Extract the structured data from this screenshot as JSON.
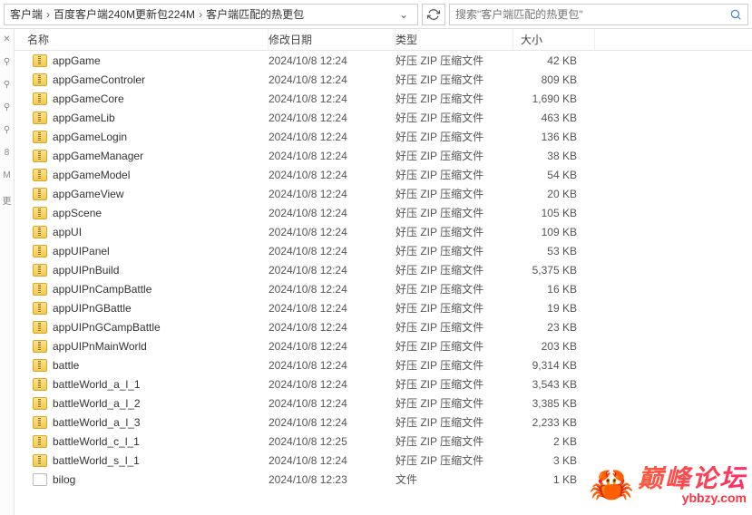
{
  "breadcrumb": {
    "seg1": "客户端",
    "seg2": "百度客户端240M更新包224M",
    "seg3": "客户端匹配的热更包"
  },
  "search": {
    "placeholder": "搜索\"客户端匹配的热更包\""
  },
  "columns": {
    "name": "名称",
    "date": "修改日期",
    "type": "类型",
    "size": "大小"
  },
  "leftStrip": {
    "i0": "✕",
    "i1": "⚲",
    "i2": "⚲",
    "i3": "⚲",
    "i4": "⚲",
    "i5": "8",
    "i6": "M",
    "i7": "更"
  },
  "watermark": {
    "crab": "🦀",
    "cn": "巅峰论坛",
    "url": "ybbzy.com"
  },
  "files": [
    {
      "name": "appGame",
      "date": "2024/10/8 12:24",
      "type": "好压 ZIP 压缩文件",
      "size": "42 KB",
      "icon": "zip"
    },
    {
      "name": "appGameControler",
      "date": "2024/10/8 12:24",
      "type": "好压 ZIP 压缩文件",
      "size": "809 KB",
      "icon": "zip"
    },
    {
      "name": "appGameCore",
      "date": "2024/10/8 12:24",
      "type": "好压 ZIP 压缩文件",
      "size": "1,690 KB",
      "icon": "zip"
    },
    {
      "name": "appGameLib",
      "date": "2024/10/8 12:24",
      "type": "好压 ZIP 压缩文件",
      "size": "463 KB",
      "icon": "zip"
    },
    {
      "name": "appGameLogin",
      "date": "2024/10/8 12:24",
      "type": "好压 ZIP 压缩文件",
      "size": "136 KB",
      "icon": "zip"
    },
    {
      "name": "appGameManager",
      "date": "2024/10/8 12:24",
      "type": "好压 ZIP 压缩文件",
      "size": "38 KB",
      "icon": "zip"
    },
    {
      "name": "appGameModel",
      "date": "2024/10/8 12:24",
      "type": "好压 ZIP 压缩文件",
      "size": "54 KB",
      "icon": "zip"
    },
    {
      "name": "appGameView",
      "date": "2024/10/8 12:24",
      "type": "好压 ZIP 压缩文件",
      "size": "20 KB",
      "icon": "zip"
    },
    {
      "name": "appScene",
      "date": "2024/10/8 12:24",
      "type": "好压 ZIP 压缩文件",
      "size": "105 KB",
      "icon": "zip"
    },
    {
      "name": "appUI",
      "date": "2024/10/8 12:24",
      "type": "好压 ZIP 压缩文件",
      "size": "109 KB",
      "icon": "zip"
    },
    {
      "name": "appUIPanel",
      "date": "2024/10/8 12:24",
      "type": "好压 ZIP 压缩文件",
      "size": "53 KB",
      "icon": "zip"
    },
    {
      "name": "appUIPnBuild",
      "date": "2024/10/8 12:24",
      "type": "好压 ZIP 压缩文件",
      "size": "5,375 KB",
      "icon": "zip"
    },
    {
      "name": "appUIPnCampBattle",
      "date": "2024/10/8 12:24",
      "type": "好压 ZIP 压缩文件",
      "size": "16 KB",
      "icon": "zip"
    },
    {
      "name": "appUIPnGBattle",
      "date": "2024/10/8 12:24",
      "type": "好压 ZIP 压缩文件",
      "size": "19 KB",
      "icon": "zip"
    },
    {
      "name": "appUIPnGCampBattle",
      "date": "2024/10/8 12:24",
      "type": "好压 ZIP 压缩文件",
      "size": "23 KB",
      "icon": "zip"
    },
    {
      "name": "appUIPnMainWorld",
      "date": "2024/10/8 12:24",
      "type": "好压 ZIP 压缩文件",
      "size": "203 KB",
      "icon": "zip"
    },
    {
      "name": "battle",
      "date": "2024/10/8 12:24",
      "type": "好压 ZIP 压缩文件",
      "size": "9,314 KB",
      "icon": "zip"
    },
    {
      "name": "battleWorld_a_l_1",
      "date": "2024/10/8 12:24",
      "type": "好压 ZIP 压缩文件",
      "size": "3,543 KB",
      "icon": "zip"
    },
    {
      "name": "battleWorld_a_l_2",
      "date": "2024/10/8 12:24",
      "type": "好压 ZIP 压缩文件",
      "size": "3,385 KB",
      "icon": "zip"
    },
    {
      "name": "battleWorld_a_l_3",
      "date": "2024/10/8 12:24",
      "type": "好压 ZIP 压缩文件",
      "size": "2,233 KB",
      "icon": "zip"
    },
    {
      "name": "battleWorld_c_l_1",
      "date": "2024/10/8 12:25",
      "type": "好压 ZIP 压缩文件",
      "size": "2 KB",
      "icon": "zip"
    },
    {
      "name": "battleWorld_s_l_1",
      "date": "2024/10/8 12:24",
      "type": "好压 ZIP 压缩文件",
      "size": "3 KB",
      "icon": "zip"
    },
    {
      "name": "bilog",
      "date": "2024/10/8 12:23",
      "type": "文件",
      "size": "1 KB",
      "icon": "doc"
    }
  ]
}
